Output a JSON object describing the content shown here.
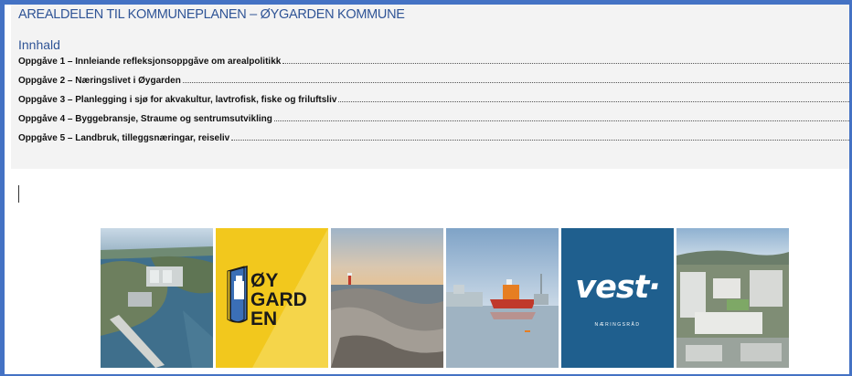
{
  "document": {
    "title": "AREALDELEN TIL KOMMUNEPLANEN – ØYGARDEN KOMMUNE",
    "toc_heading": "Innhald",
    "toc_items": [
      {
        "label": "Oppgåve 1 – Innleiande refleksjonsoppgåve om arealpolitikk"
      },
      {
        "label": "Oppgåve 2 – Næringslivet i Øygarden"
      },
      {
        "label": "Oppgåve 3 – Planlegging i sjø for akvakultur, lavtrofisk, fiske og friluftsliv"
      },
      {
        "label": "Oppgåve 4 – Byggebransje, Straume og sentrumsutvikling"
      },
      {
        "label": "Oppgåve 5 – Landbruk, tilleggsnæringar, reiseliv"
      }
    ]
  },
  "banner": {
    "oygarden_logo": {
      "line1": "ØY",
      "line2": "GARD",
      "line3": "EN"
    },
    "vest_logo": {
      "word": "vest·",
      "subtitle": "NÆRINGSRÅD"
    }
  },
  "colors": {
    "frame": "#4472c4",
    "title_blue": "#2f5496",
    "oygarden_yellow": "#f2c81d",
    "vest_blue": "#1f5f8e"
  }
}
